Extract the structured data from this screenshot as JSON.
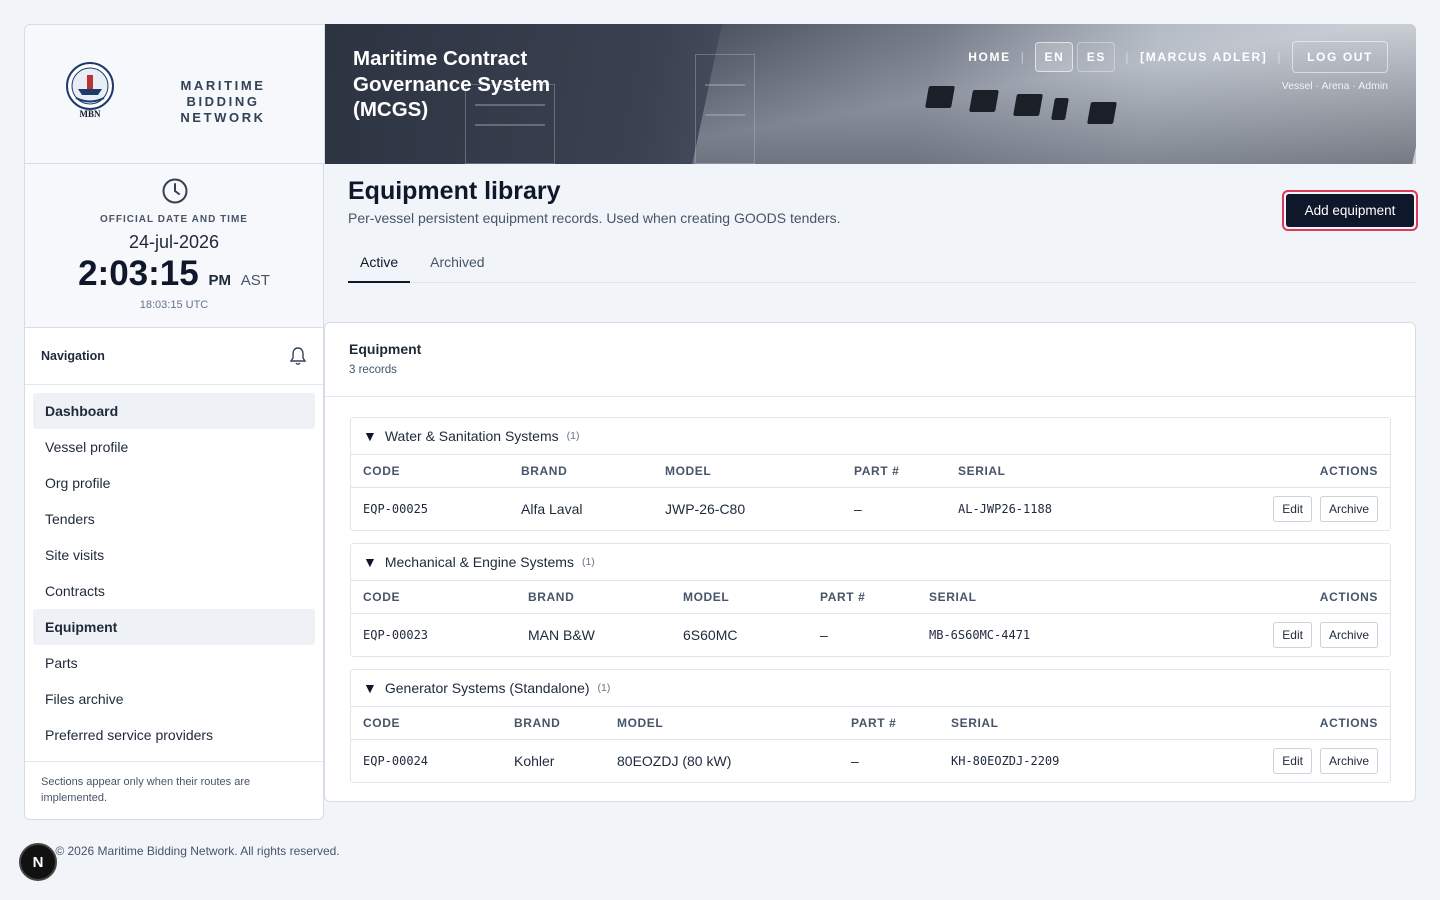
{
  "brand": {
    "logo_text": "MBN",
    "name": "MARITIME BIDDING NETWORK"
  },
  "header": {
    "title": "Maritime Contract Governance System (MCGS)",
    "home": "HOME",
    "lang_en": "EN",
    "lang_es": "ES",
    "user": "[MARCUS ADLER]",
    "logout": "LOG OUT",
    "roles": "Vessel · Arena · Admin"
  },
  "clock": {
    "label": "OFFICIAL DATE AND TIME",
    "date": "24-jul-2026",
    "time": "2:03:15",
    "suffix": "PM",
    "tz": "AST",
    "utc": "18:03:15 UTC"
  },
  "nav": {
    "title": "Navigation",
    "items": [
      {
        "label": "Dashboard"
      },
      {
        "label": "Vessel profile"
      },
      {
        "label": "Org profile"
      },
      {
        "label": "Tenders"
      },
      {
        "label": "Site visits"
      },
      {
        "label": "Contracts"
      },
      {
        "label": "Equipment"
      },
      {
        "label": "Parts"
      },
      {
        "label": "Files archive"
      },
      {
        "label": "Preferred service providers"
      }
    ],
    "note": "Sections appear only when their routes are implemented."
  },
  "page": {
    "title": "Equipment library",
    "subtitle": "Per-vessel persistent equipment records. Used when creating GOODS tenders.",
    "add_button": "Add equipment",
    "tabs": [
      "Active",
      "Archived"
    ]
  },
  "card": {
    "title": "Equipment",
    "subtitle": "3 records"
  },
  "columns": {
    "code": "CODE",
    "brand": "BRAND",
    "model": "MODEL",
    "part": "PART #",
    "serial": "SERIAL",
    "actions": "ACTIONS"
  },
  "row_actions": {
    "edit": "Edit",
    "archive": "Archive"
  },
  "groups": [
    {
      "name": "Water & Sanitation Systems",
      "count": "(1)",
      "row": {
        "code": "EQP-00025",
        "brand": "Alfa Laval",
        "model": "JWP-26-C80",
        "part": "–",
        "serial": "AL-JWP26-1188"
      }
    },
    {
      "name": "Mechanical & Engine Systems",
      "count": "(1)",
      "row": {
        "code": "EQP-00023",
        "brand": "MAN B&W",
        "model": "6S60MC",
        "part": "–",
        "serial": "MB-6S60MC-4471"
      }
    },
    {
      "name": "Generator Systems (Standalone)",
      "count": "(1)",
      "row": {
        "code": "EQP-00024",
        "brand": "Kohler",
        "model": "80EOZDJ (80 kW)",
        "part": "–",
        "serial": "KH-80EOZDJ-2209"
      }
    }
  ],
  "footer": "· © 2026 Maritime Bidding Network. All rights reserved.",
  "dev_badge": "N"
}
